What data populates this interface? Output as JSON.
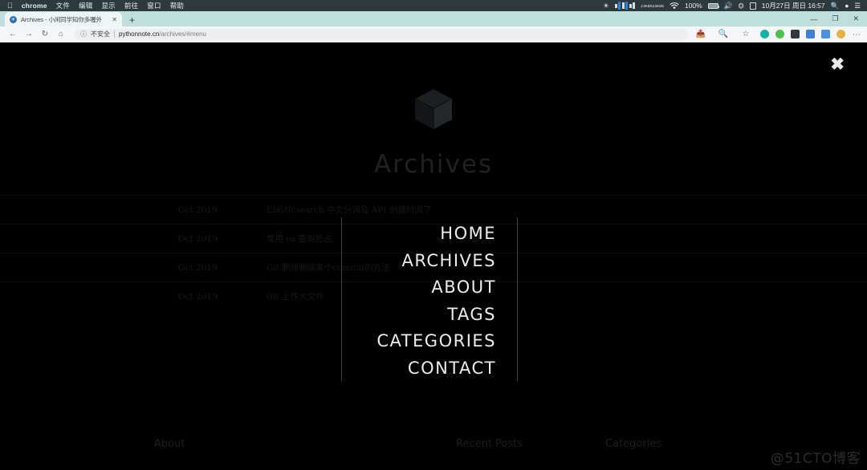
{
  "os_menubar": {
    "apple_icon": "apple-icon",
    "app_name": "chrome",
    "menus": [
      "文件",
      "编辑",
      "显示",
      "前往",
      "窗口",
      "帮助"
    ],
    "status": {
      "brightness_icon": "brightness-icon",
      "network_speed_up": "2.0KB/s",
      "network_speed_down": "3.5KB/s",
      "wifi_icon": "wifi-icon",
      "battery_percent": "100%",
      "battery_icon": "battery-icon",
      "volume_icon": "volume-icon",
      "eject_icon": "eject-icon",
      "input_icon": "input-source-icon",
      "datetime": "10月27日 周日 16:57",
      "search_icon": "spotlight-search-icon",
      "siri_icon": "siri-icon",
      "control_center_icon": "control-center-icon"
    }
  },
  "browser": {
    "tab": {
      "favicon": "site-favicon",
      "title": "Archives - 小闲同学知你多喔外",
      "close_icon": "close-tab-icon"
    },
    "new_tab_label": "+",
    "window_controls": {
      "minimize": "—",
      "maximize": "❐",
      "close": "✕"
    },
    "toolbar": {
      "back_icon": "back-arrow-icon",
      "forward_icon": "forward-arrow-icon",
      "reload_icon": "reload-icon",
      "home_icon": "home-icon",
      "security_icon": "info-circle-icon",
      "security_label": "不安全",
      "url_host": "pythonnote.cn",
      "url_path": "/archives/#menu",
      "share_icon": "share-icon",
      "zoom_icon": "search-page-icon",
      "bookmark_icon": "star-icon",
      "extensions": [
        "extension-teal-icon",
        "extension-green-icon",
        "extension-dark-icon",
        "extension-blue-icon",
        "extension-blue2-icon"
      ],
      "profile_icon": "profile-avatar-icon",
      "menu_icon": "kebab-menu-icon"
    }
  },
  "page": {
    "close_overlay_icon": "close-overlay-icon",
    "logo_icon": "cube-logo-icon",
    "site_title": "Archives",
    "nav_items": [
      {
        "label": "HOME"
      },
      {
        "label": "ARCHIVES"
      },
      {
        "label": "ABOUT"
      },
      {
        "label": "TAGS"
      },
      {
        "label": "CATEGORIES"
      },
      {
        "label": "CONTACT"
      }
    ],
    "archives": [
      {
        "date": "Oct 2019",
        "title": "Elasticsearch 中文分词及 API 创建时间了"
      },
      {
        "date": "Oct 2019",
        "title": "常用 es 查询总占"
      },
      {
        "date": "Oct 2019",
        "title": "Git 删除删除某个commit的方法"
      },
      {
        "date": "Oct 2019",
        "title": "Git 上传大文件"
      }
    ],
    "footer": {
      "about": "About",
      "recent_posts": "Recent Posts",
      "categories": "Categories"
    },
    "watermark": "@51CTO博客"
  },
  "colors": {
    "page_bg": "#000000",
    "menubar_bg": "#2c3a3e",
    "tabstrip_bg": "#bfdfdc",
    "toolbar_bg": "#f4f6f7",
    "nav_text": "#e9edef",
    "dim_text": "#16191b"
  }
}
